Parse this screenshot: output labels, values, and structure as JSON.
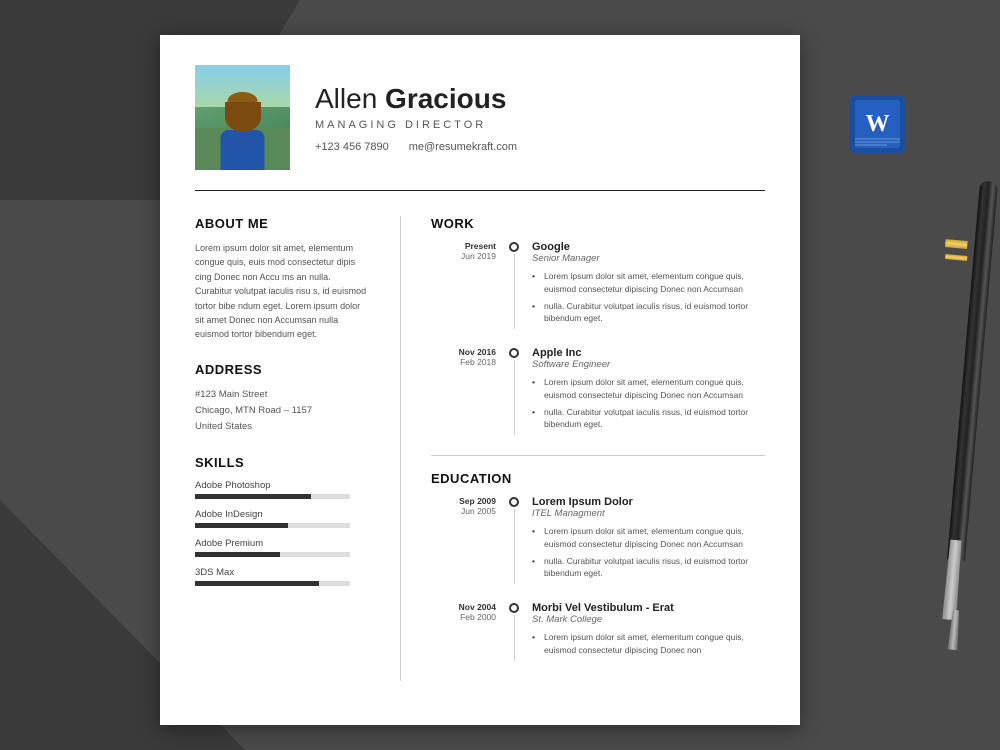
{
  "page": {
    "background_color": "#4a4a4a"
  },
  "resume": {
    "header": {
      "name_first": "Allen ",
      "name_last": "Gracious",
      "title": "MANAGING  DIRECTOR",
      "phone": "+123 456 7890",
      "email": "me@resumekraft.com"
    },
    "about": {
      "section_title": "ABOUT ME",
      "text": "Lorem ipsum dolor sit amet, elementum congue quis, euis mod  consectetur dipis cing Donec non Accu ms an nulla. Curabitur volutpat iaculis risu s, id euismod tortor bibe ndum eget. Lorem ipsum dolor sit amet Donec non Accumsan nulla euismod tortor bibendum eget."
    },
    "address": {
      "section_title": "ADDRESS",
      "line1": "#123 Main Street",
      "line2": "Chicago, MTN Road – 1157",
      "line3": "United States"
    },
    "skills": {
      "section_title": "SKILLS",
      "items": [
        {
          "name": "Adobe Photoshop",
          "percent": 75
        },
        {
          "name": "Adobe InDesign",
          "percent": 60
        },
        {
          "name": "Adobe Premium",
          "percent": 55
        },
        {
          "name": "3DS Max",
          "percent": 80
        }
      ]
    },
    "work": {
      "section_title": "WORK",
      "items": [
        {
          "date_top": "Present",
          "date_bottom": "Jun 2019",
          "company": "Google",
          "role": "Senior Manager",
          "bullets": [
            "Lorem ipsum dolor sit amet, elementum congue quis, euismod  consectetur dipiscing Donec non Accumsan",
            "nulla. Curabitur volutpat iaculis risus, id euismod tortor bibendum eget."
          ]
        },
        {
          "date_top": "Nov 2016",
          "date_bottom": "Feb 2018",
          "company": "Apple Inc",
          "role": "Software Engineer",
          "bullets": [
            "Lorem ipsum dolor sit amet, elementum congue quis, euismod  consectetur dipiscing Donec non Accumsan",
            "nulla. Curabitur volutpat iaculis risus, id euismod tortor bibendum eget."
          ]
        }
      ]
    },
    "education": {
      "section_title": "EDUCATION",
      "items": [
        {
          "date_top": "Sep 2009",
          "date_bottom": "Jun 2005",
          "company": "Lorem Ipsum Dolor",
          "role": "ITEL Managment",
          "bullets": [
            "Lorem ipsum dolor sit amet, elementum congue quis, euismod  consectetur dipiscing Donec non Accumsan",
            "nulla. Curabitur volutpat iaculis risus, id euismod tortor bibendum eget."
          ]
        },
        {
          "date_top": "Nov 2004",
          "date_bottom": "Feb 2000",
          "company": "Morbi Vel Vestibulum - Erat",
          "role": "St. Mark College",
          "bullets": [
            "Lorem ipsum dolor sit amet, elementum congue quis, euismod  consectetur dipiscing Donec non"
          ]
        }
      ]
    }
  },
  "word_icon": {
    "label": "W"
  }
}
